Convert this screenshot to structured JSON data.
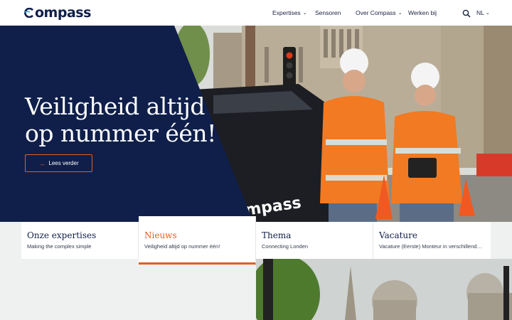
{
  "brand": {
    "name": "ompass",
    "navy": "#0f1f4a",
    "orange": "#e85d1e"
  },
  "nav": {
    "items": [
      {
        "label": "Expertises",
        "has_dropdown": true
      },
      {
        "label": "Sensoren",
        "has_dropdown": false
      },
      {
        "label": "Over Compass",
        "has_dropdown": true
      },
      {
        "label": "Werken bij",
        "has_dropdown": false
      }
    ],
    "language": "NL",
    "search_icon": "search-icon"
  },
  "hero": {
    "title_line1": "Veiligheid altijd",
    "title_line2": "op nummer één!",
    "button_label": "Lees verder",
    "vehicle_text": "ompass"
  },
  "cards": [
    {
      "title": "Onze expertises",
      "subtitle": "Making the complex simple",
      "active": false
    },
    {
      "title": "Nieuws",
      "subtitle": "Veiligheid altijd op nummer één!",
      "active": true
    },
    {
      "title": "Thema",
      "subtitle": "Connecting Londen",
      "active": false
    },
    {
      "title": "Vacature",
      "subtitle": "Vacature (Eerste) Monteur in verschillende ...",
      "active": false
    }
  ]
}
